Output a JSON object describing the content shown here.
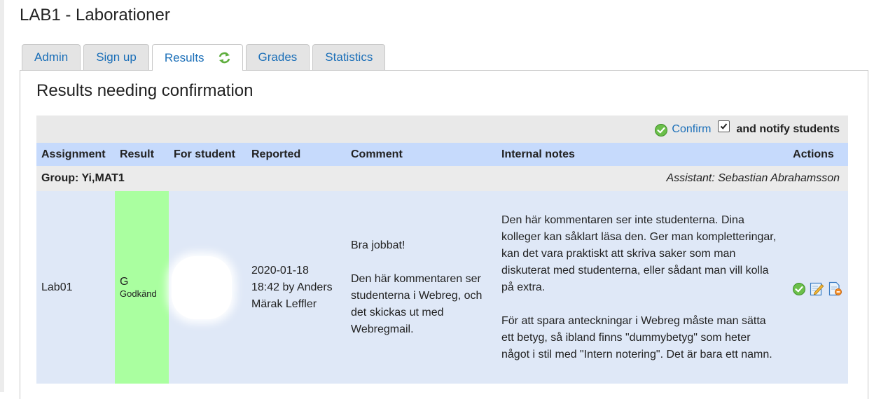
{
  "page": {
    "title": "LAB1 - Laborationer"
  },
  "tabs": [
    {
      "label": "Admin",
      "active": false
    },
    {
      "label": "Sign up",
      "active": false
    },
    {
      "label": "Results",
      "active": true,
      "icon": "refresh-icon"
    },
    {
      "label": "Grades",
      "active": false
    },
    {
      "label": "Statistics",
      "active": false
    }
  ],
  "section": {
    "title": "Results needing confirmation",
    "confirm_label": "Confirm",
    "notify_checked": true,
    "notify_label": "and notify students"
  },
  "columns": [
    "Assignment",
    "Result",
    "For student",
    "Reported",
    "Comment",
    "Internal notes",
    "Actions"
  ],
  "group": {
    "label": "Group: Yi,MAT1",
    "assistant": "Assistant: Sebastian Abrahamsson"
  },
  "rows": [
    {
      "assignment": "Lab01",
      "result_grade": "G",
      "result_name": "Godkänd",
      "result_color": "#aaffa0",
      "student": "",
      "reported_line1": "2020-01-18",
      "reported_line2": "18:42 by Anders",
      "reported_line3": "Märak Leffler",
      "comment_p1": "Bra jobbat!",
      "comment_p2": "Den här kommentaren ser studenterna i Webreg, och det skickas ut med Webregmail.",
      "notes_p1": "Den här kommentaren ser inte studenterna. Dina kolleger kan såklart läsa den. Ger man kompletteringar, kan det vara praktiskt att skriva saker som man diskuterat med studenterna, eller sådant man vill kolla på extra.",
      "notes_p2": "För att spara anteckningar i Webreg måste man sätta ett betyg, så ibland finns \"dummybetyg\" som heter något i stil med \"Intern notering\". Det är bara ett namn.",
      "actions": [
        "confirm-icon",
        "edit-icon",
        "remove-icon"
      ]
    }
  ],
  "colors": {
    "link": "#1b6fb8",
    "header_bg": "#c6dafc",
    "row_bg": "#dfe8f7",
    "group_bg": "#ebebeb",
    "confirm_bar_bg": "#e9e9e9",
    "approved": "#aaffa0"
  }
}
